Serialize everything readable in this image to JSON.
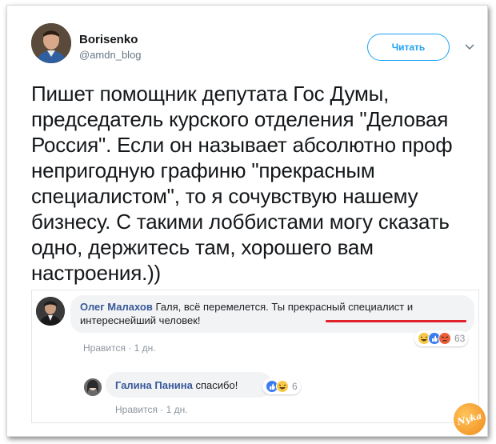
{
  "tweet": {
    "author_name": "Borisenko",
    "author_handle": "@amdn_blog",
    "follow_label": "Читать",
    "text": "Пишет помощник депутата Гос Думы, председатель курского отделения \"Деловая Россия\". Если он называет абсолютно проф непригодную графиню \"прекрасным специалистом\", то я сочувствую нашему бизнесу. С такими лоббистами могу сказать одно, держитесь там, хорошего вам настроения.))"
  },
  "embed": {
    "comment1": {
      "author": "Олег Малахов",
      "text": "Галя, всё перемелется. Ты прекрасный специалист и интереснейший человек!",
      "like_label": "Нравится",
      "time": "1 дн.",
      "reactions": [
        "haha",
        "like",
        "angry"
      ],
      "reaction_count": "63"
    },
    "comment2": {
      "author": "Галина Панина",
      "text": "спасибо!",
      "like_label": "Нравится",
      "time": "1 дн.",
      "reactions": [
        "like",
        "haha"
      ],
      "reaction_count": "6"
    }
  },
  "colors": {
    "twitter_blue": "#1da1f2",
    "fb_name": "#385898",
    "underline": "#e0232a"
  },
  "watermark_text": "Nyka"
}
